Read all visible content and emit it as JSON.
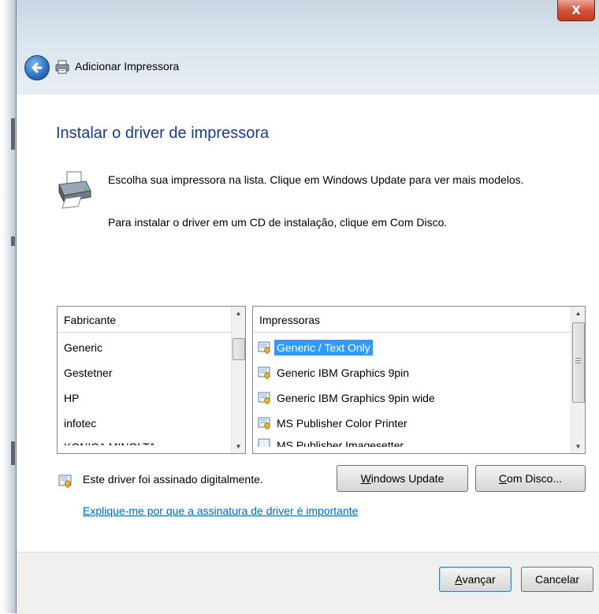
{
  "window": {
    "title": "Adicionar Impressora",
    "close_label": "X"
  },
  "page": {
    "heading": "Instalar o driver de impressora",
    "description_1": "Escolha sua impressora na lista. Clique em Windows Update para ver mais modelos.",
    "description_2": "Para instalar o driver em um CD de instalação, clique em Com Disco."
  },
  "manufacturer_list": {
    "header": "Fabricante",
    "items": [
      "Generic",
      "Gestetner",
      "HP",
      "infotec",
      "KONICA MINOLTA"
    ],
    "selected": "Generic"
  },
  "printer_list": {
    "header": "Impressoras",
    "items": [
      "Generic / Text Only",
      "Generic IBM Graphics 9pin",
      "Generic IBM Graphics 9pin wide",
      "MS Publisher Color Printer",
      "MS Publisher Imagesetter"
    ],
    "selected": "Generic / Text Only"
  },
  "signature": {
    "text": "Este driver foi assinado digitalmente.",
    "link": "Explique-me por que a assinatura de driver é importante"
  },
  "buttons": {
    "windows_update": {
      "accel": "W",
      "rest": "indows Update"
    },
    "com_disco": {
      "accel": "C",
      "rest": "om Disco..."
    },
    "avancar": {
      "accel": "A",
      "rest": "vançar"
    },
    "cancelar": "Cancelar"
  },
  "colors": {
    "heading": "#1c3a8c",
    "link": "#0066cc",
    "selection": "#3399ff",
    "close_button": "#d4543c"
  },
  "icons": {
    "back": "back-arrow-icon",
    "printer": "printer-icon",
    "driver": "signed-driver-icon"
  }
}
